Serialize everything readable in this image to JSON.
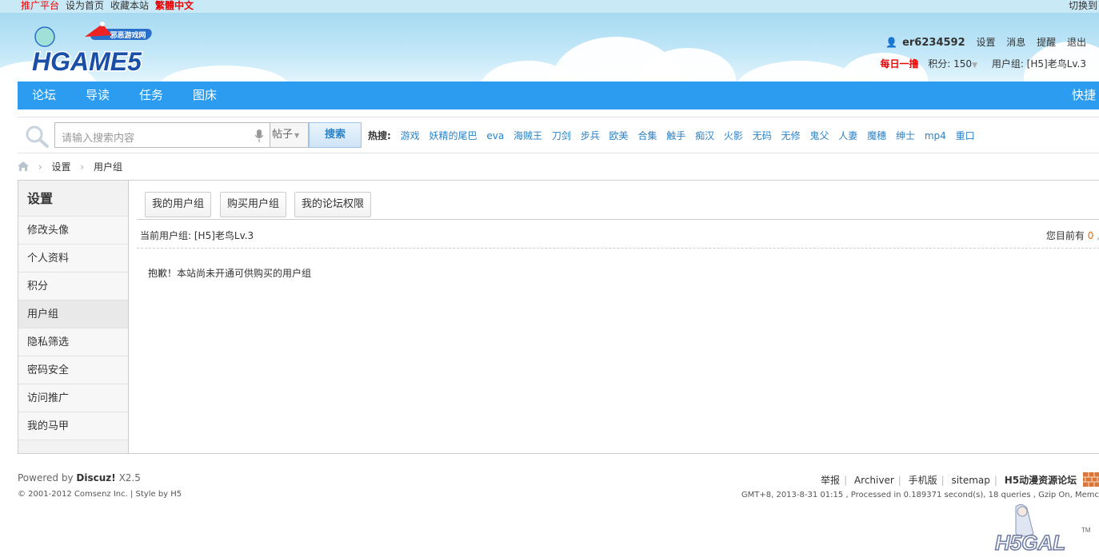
{
  "topbar": {
    "promo": "推广平台",
    "set_home": "设为首页",
    "bookmark": "收藏本站",
    "trad_chinese": "繁體中文",
    "switch": "切换到"
  },
  "header": {
    "logo_text": "HGAME5",
    "logo_sub": "邪恶游戏网",
    "username": "er6234592",
    "links": [
      "设置",
      "消息",
      "提醒",
      "退出"
    ],
    "daily": "每日一撸",
    "points": "积分: 150",
    "usergroup": "用户组: [H5]老鸟Lv.3"
  },
  "nav": {
    "items": [
      "论坛",
      "导读",
      "任务",
      "图床"
    ],
    "quick": "快捷"
  },
  "search": {
    "placeholder": "请输入搜索内容",
    "type": "帖子",
    "button": "搜索",
    "hot_label": "热搜:",
    "hot": [
      "游戏",
      "妖精的尾巴",
      "eva",
      "海贼王",
      "刀剑",
      "步兵",
      "欧美",
      "合集",
      "触手",
      "痴汉",
      "火影",
      "无码",
      "无修",
      "鬼父",
      "人妻",
      "魔穗",
      "绅士",
      "mp4",
      "重口"
    ]
  },
  "breadcrumb": {
    "items": [
      "设置",
      "用户组"
    ]
  },
  "sidebar": {
    "title": "设置",
    "items": [
      "修改头像",
      "个人资料",
      "积分",
      "用户组",
      "隐私筛选",
      "密码安全",
      "访问推广",
      "我的马甲"
    ]
  },
  "main": {
    "tabs": [
      "我的用户组",
      "购买用户组",
      "我的论坛权限"
    ],
    "current_group": "当前用户组: [H5]老鸟Lv.3",
    "currency_label": "您目前有",
    "currency_value": "0",
    "notice": "抱歉！本站尚未开通可供购买的用户组"
  },
  "footer": {
    "powered_prefix": "Powered by",
    "powered_brand": "Discuz!",
    "powered_version": "X2.5",
    "copyright": "© 2001-2012 Comsenz Inc. | Style by H5",
    "links": [
      "举报",
      "Archiver",
      "手机版",
      "sitemap",
      "H5动漫资源论坛"
    ],
    "meta": "GMT+8, 2013-8-31 01:15 , Processed in 0.189371 second(s), 18 queries , Gzip On, Memc",
    "logo_text": "H5GAL"
  }
}
